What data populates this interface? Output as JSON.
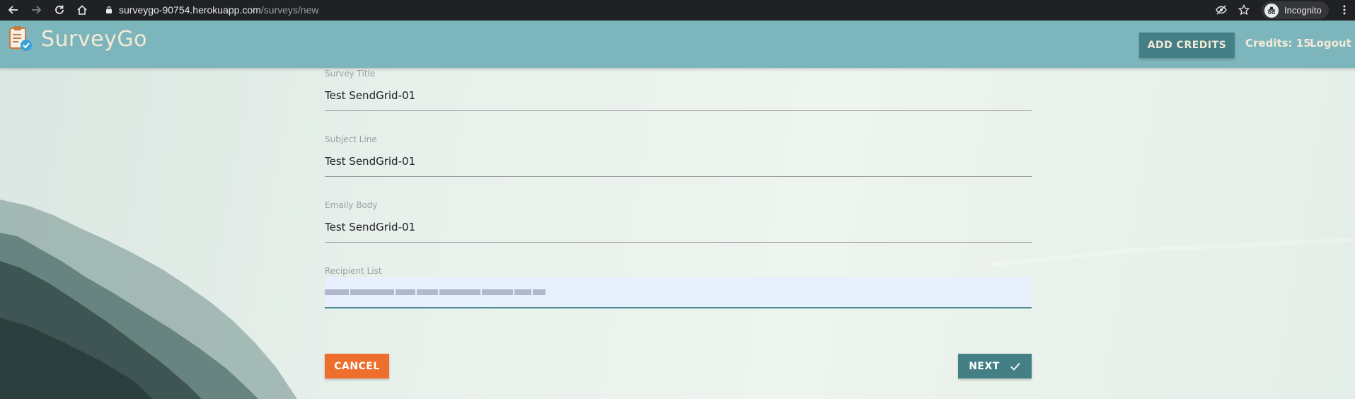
{
  "browser": {
    "url_host": "surveygo-90754.herokuapp.com",
    "url_path": "/surveys/new",
    "profile_label": "Incognito",
    "icons": [
      "back-icon",
      "forward-icon",
      "reload-icon",
      "home-icon",
      "lock-icon",
      "eye-off-icon",
      "star-icon",
      "incognito-icon",
      "more-icon"
    ]
  },
  "header": {
    "brand": "SurveyGo",
    "add_credits_label": "ADD CREDITS",
    "credits_text": "Credits: 15",
    "logout_label": "Logout",
    "bar_color": "#7db5bd",
    "accent_color": "#457f86"
  },
  "form": {
    "fields": [
      {
        "label": "Survey Title",
        "value": "Test SendGrid-01"
      },
      {
        "label": "Subject Line",
        "value": "Test SendGrid-01"
      },
      {
        "label": "Emaily Body",
        "value": "Test SendGrid-01"
      },
      {
        "label": "Recipient List",
        "value": ""
      }
    ],
    "cancel_label": "CANCEL",
    "next_label": "NEXT",
    "cancel_color": "#ee6e2c"
  }
}
